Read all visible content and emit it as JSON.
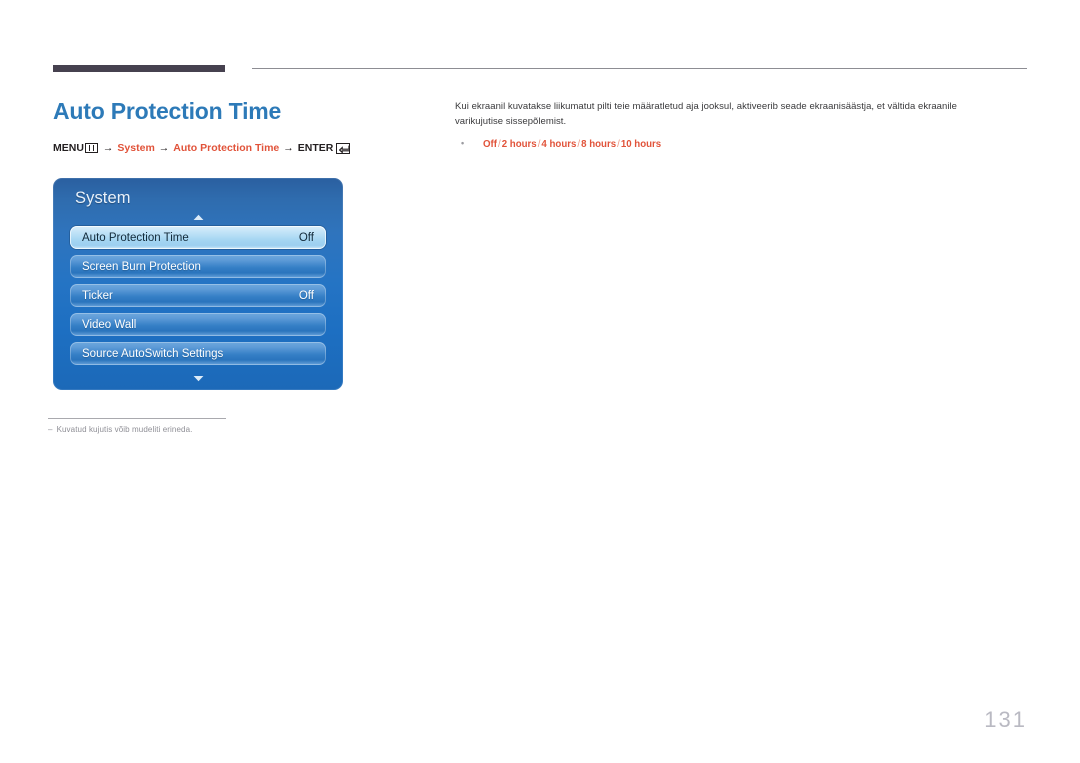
{
  "document": {
    "page_number": "131"
  },
  "header": {
    "title": "Auto Protection Time"
  },
  "menu_path": {
    "menu_label": "MENU",
    "menu_icon": "menu-grid-icon",
    "arrow": "→",
    "step1": "System",
    "step2": "Auto Protection Time",
    "enter_label": "ENTER",
    "enter_icon": "enter-return-icon"
  },
  "osd": {
    "title": "System",
    "scroll_up_icon": "chevron-up-icon",
    "scroll_down_icon": "chevron-down-icon",
    "rows": [
      {
        "label": "Auto Protection Time",
        "value": "Off",
        "selected": true
      },
      {
        "label": "Screen Burn Protection",
        "value": "",
        "selected": false
      },
      {
        "label": "Ticker",
        "value": "Off",
        "selected": false
      },
      {
        "label": "Video Wall",
        "value": "",
        "selected": false
      },
      {
        "label": "Source AutoSwitch Settings",
        "value": "",
        "selected": false
      }
    ]
  },
  "footnote": {
    "dash": "–",
    "text": "Kuvatud kujutis võib mudeliti erineda."
  },
  "description": {
    "paragraph": "Kui ekraanil kuvatakse liikumatut pilti teie määratletud aja jooksul, aktiveerib seade ekraanisäästja, et vältida ekraanile varikujutise sissepõlemist.",
    "options": [
      "Off",
      "2 hours",
      "4 hours",
      "8 hours",
      "10 hours"
    ],
    "separator": "/"
  },
  "colors": {
    "title_blue": "#2d7ab8",
    "accent_orange": "#e1533a",
    "rule_dark": "#46414f",
    "osd_blue": "#2574c4",
    "page_number_gray": "#b9b9c2"
  }
}
